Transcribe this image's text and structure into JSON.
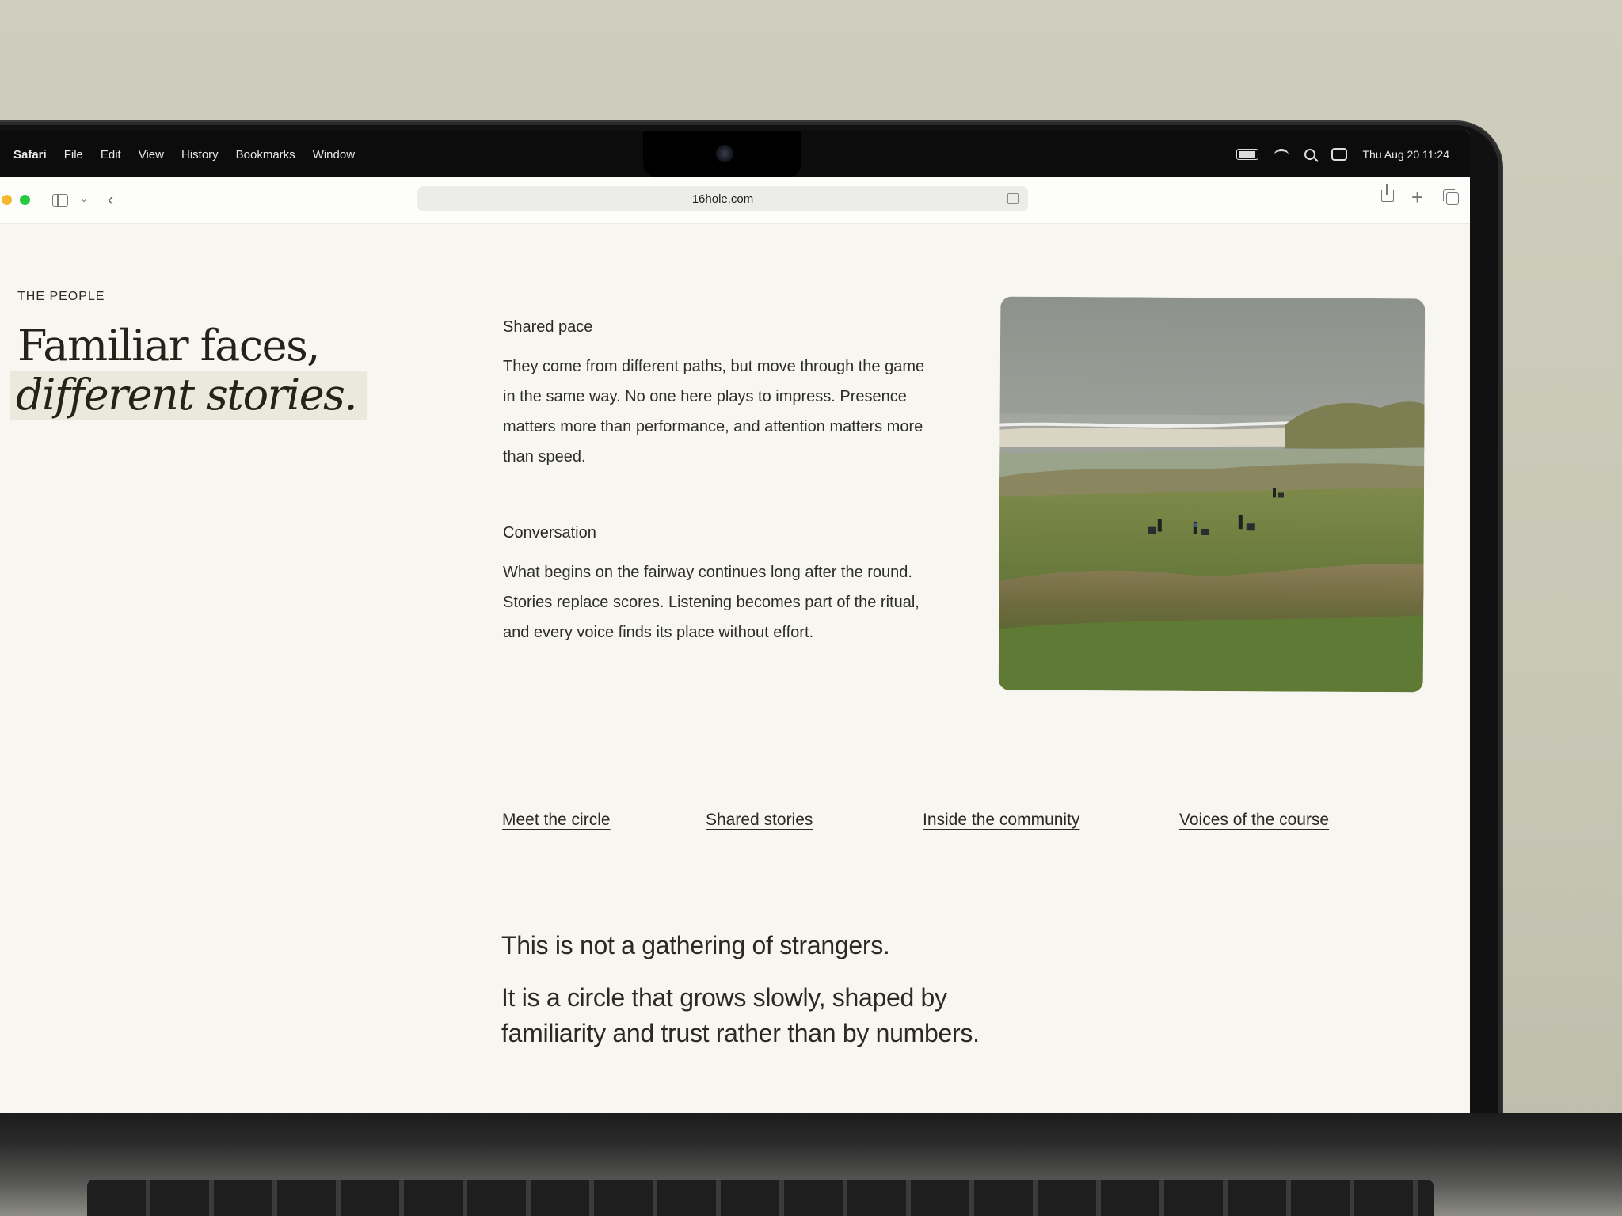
{
  "menubar": {
    "app": "Safari",
    "menus": [
      "File",
      "Edit",
      "View",
      "History",
      "Bookmarks",
      "Window"
    ],
    "datetime": "Thu Aug 20  11:24"
  },
  "browser": {
    "url": "16hole.com"
  },
  "page": {
    "eyebrow": "THE PEOPLE",
    "headline_line1": "Familiar faces,",
    "headline_line2": "different stories.",
    "sections": [
      {
        "title": "Shared pace",
        "body": "They come from different paths, but move through the game in the same way. No one here plays to impress. Presence matters more than performance, and attention matters more than speed."
      },
      {
        "title": "Conversation",
        "body": "What begins on the fairway continues long after the round. Stories replace scores. Listening becomes part of the ritual, and every voice finds its place without effort."
      }
    ],
    "links": [
      "Meet the circle",
      "Shared stories",
      "Inside the community",
      "Voices of the course"
    ],
    "closing_line1": "This is not a gathering of strangers.",
    "closing_line2": "It is a circle that grows slowly, shaped by familiarity and trust rather than by numbers."
  }
}
